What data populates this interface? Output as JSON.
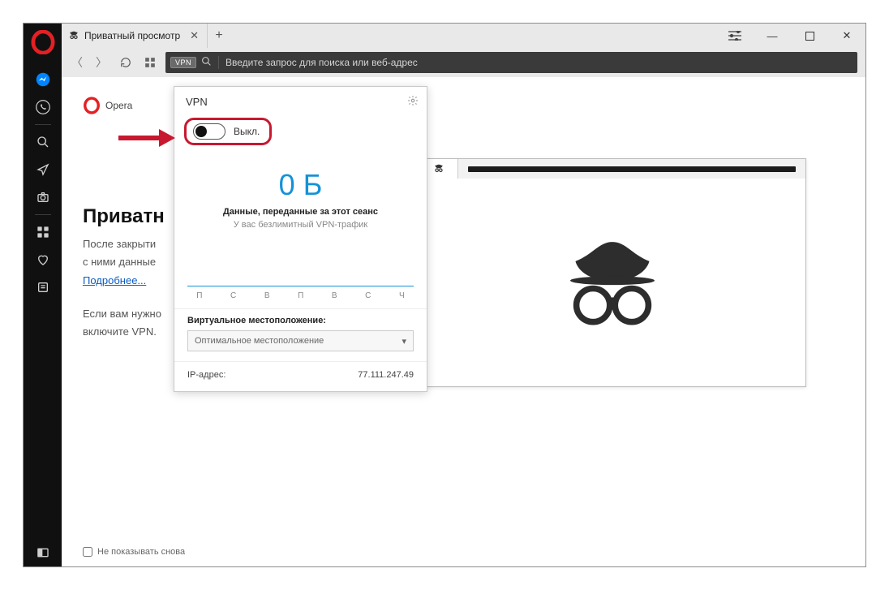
{
  "tab": {
    "title": "Приватный просмотр"
  },
  "addressbar": {
    "vpn_badge": "VPN",
    "placeholder": "Введите запрос для поиска или веб-адрес"
  },
  "brand": {
    "name": "Opera"
  },
  "page": {
    "title_partial": "Приватн",
    "p1_partial": "После закрыти",
    "p2_partial": "с ними данные",
    "link": "Подробнее...",
    "p3_partial_a": "Если вам нужно",
    "p3_partial_b": "включите VPN.",
    "checkbox_label": "Не показывать снова"
  },
  "vpn": {
    "title": "VPN",
    "toggle_state": "Выкл.",
    "transferred": "0 Б",
    "transferred_caption": "Данные, переданные за этот сеанс",
    "unlimited_caption": "У вас безлимитный VPN-трафик",
    "days": [
      "П",
      "С",
      "В",
      "П",
      "В",
      "С",
      "Ч"
    ],
    "location_label": "Виртуальное местоположение:",
    "location_value": "Оптимальное местоположение",
    "ip_label": "IP-адрес:",
    "ip_value": "77.111.247.49"
  }
}
